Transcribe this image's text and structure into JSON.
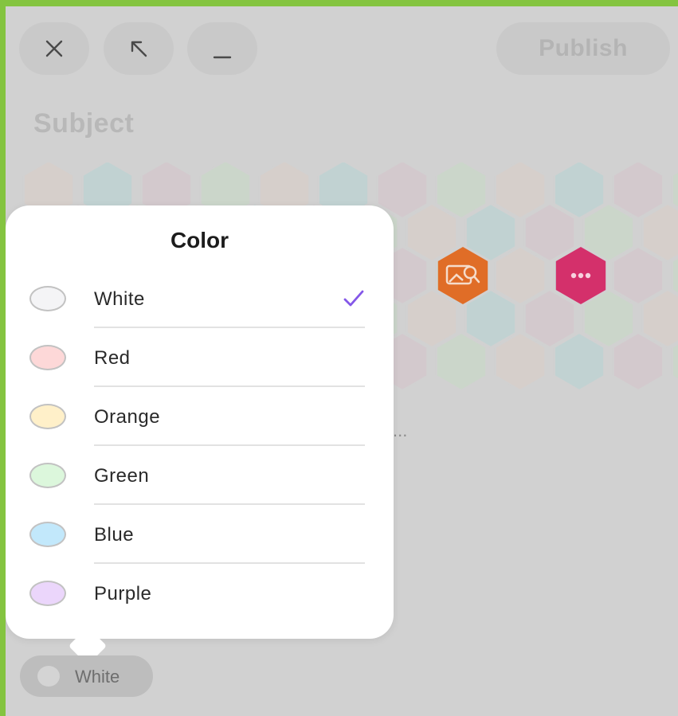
{
  "window_controls": {
    "close_icon": "close-icon",
    "expand_icon": "arrow-up-left-icon",
    "minimize_icon": "minimize-icon"
  },
  "header": {
    "publish_label": "Publish",
    "subject_placeholder": "Subject"
  },
  "hex_grid": {
    "tile_colors": [
      "#d6cfcb",
      "#c1d2d2",
      "#d3c9cd",
      "#cbd6ca"
    ],
    "highlight_tiles": [
      {
        "icon": "image-search-icon",
        "color": "#e06d27"
      },
      {
        "icon": "more-icon",
        "color": "#d4306b"
      }
    ]
  },
  "content": {
    "ellipsis": "..."
  },
  "color_picker": {
    "title": "Color",
    "selected": "White",
    "check_color": "#8457e8",
    "options": [
      {
        "label": "White",
        "swatch": "#f4f4f6",
        "selected": true
      },
      {
        "label": "Red",
        "swatch": "#fdd8d8",
        "selected": false
      },
      {
        "label": "Orange",
        "swatch": "#fff0c9",
        "selected": false
      },
      {
        "label": "Green",
        "swatch": "#dcf7dc",
        "selected": false
      },
      {
        "label": "Blue",
        "swatch": "#c2e8fb",
        "selected": false
      },
      {
        "label": "Purple",
        "swatch": "#ebd6fb",
        "selected": false
      }
    ]
  },
  "color_pill": {
    "label": "White"
  }
}
